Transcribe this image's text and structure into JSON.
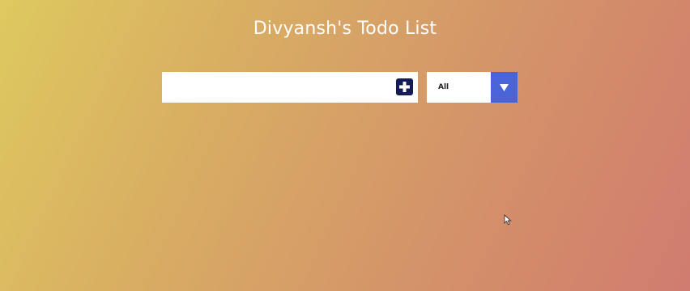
{
  "app": {
    "title": "Divyansh's Todo List"
  },
  "todo_form": {
    "input_value": "",
    "add_icon": "plus-square-icon"
  },
  "filter": {
    "selected": "All",
    "arrow_icon": "triangle-down-icon"
  },
  "colors": {
    "background_start": "#dec95f",
    "background_end": "#d07c70",
    "add_button": "#141c57",
    "filter_arrow": "#4a63d6",
    "title_text": "#ffffff"
  }
}
